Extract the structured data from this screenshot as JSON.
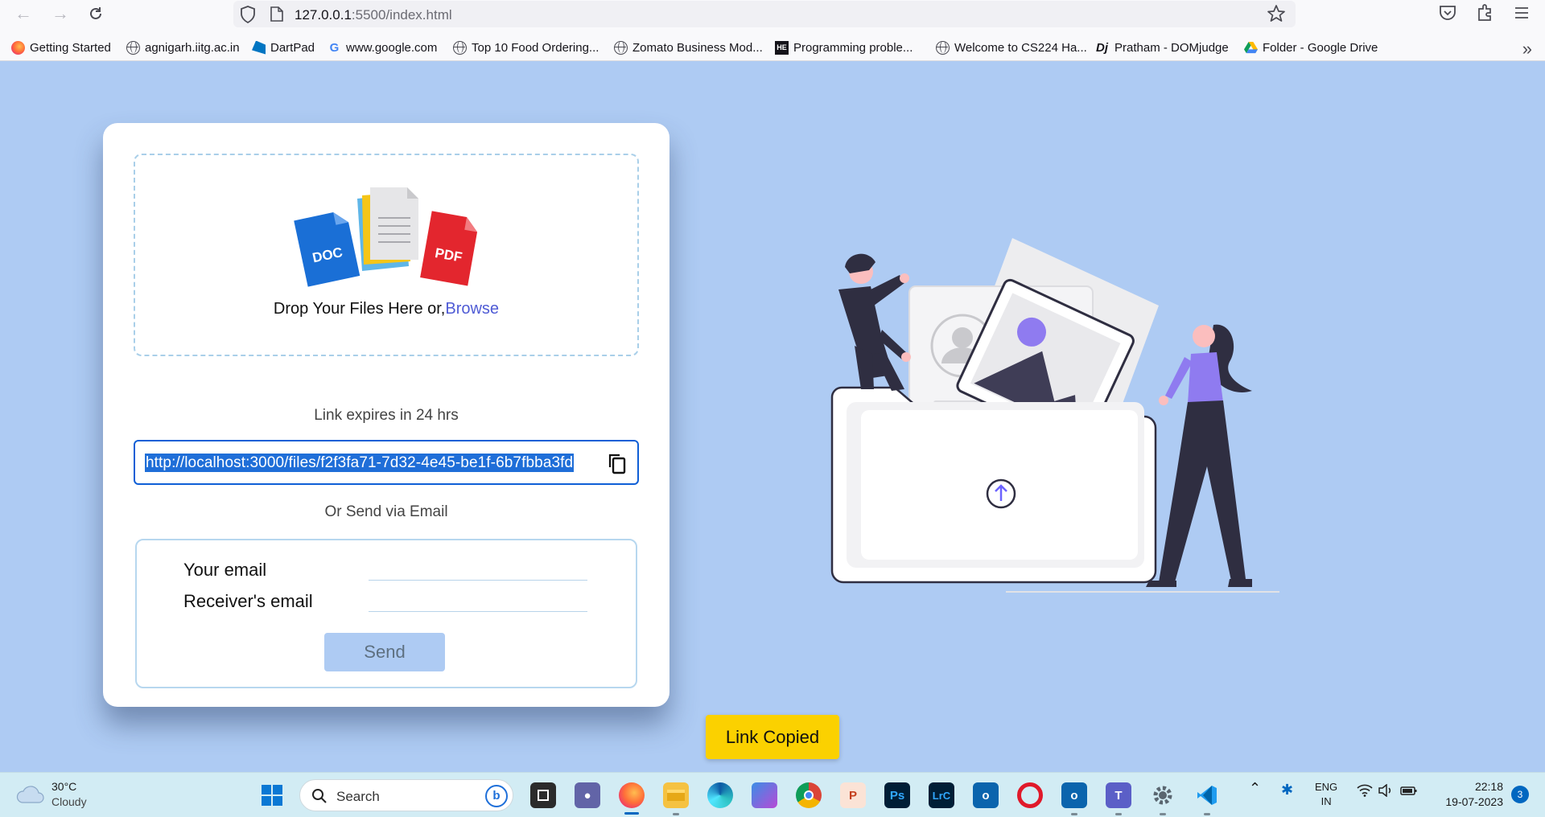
{
  "browser": {
    "url_host": "127.0.0.1",
    "url_rest": ":5500/index.html",
    "bookmarks": [
      {
        "label": "Getting Started",
        "icon": "firefox-icon"
      },
      {
        "label": "agnigarh.iitg.ac.in",
        "icon": "globe-icon"
      },
      {
        "label": "DartPad",
        "icon": "dart-icon"
      },
      {
        "label": "www.google.com",
        "icon": "google-icon"
      },
      {
        "label": "Top 10 Food Ordering...",
        "icon": "globe-icon"
      },
      {
        "label": "Zomato Business Mod...",
        "icon": "globe-icon"
      },
      {
        "label": "Programming proble...",
        "icon": "hackerearth-icon"
      },
      {
        "label": "Welcome to CS224 Ha...",
        "icon": "globe-icon"
      },
      {
        "label": "Pratham - DOMjudge",
        "icon": "domjudge-icon"
      },
      {
        "label": "Folder - Google Drive",
        "icon": "google-drive-icon"
      }
    ]
  },
  "card": {
    "drop_text": "Drop Your Files Here or,",
    "browse_label": "Browse",
    "expires_text": "Link expires in 24 hrs",
    "share_link": "http://localhost:3000/files/f2f3fa71-7d32-4e45-be1f-6b7fbba3fd",
    "or_send_text": "Or Send via Email",
    "your_email_label": "Your email",
    "receiver_email_label": "Receiver's email",
    "send_label": "Send",
    "doc_badge": "DOC",
    "pdf_badge": "PDF"
  },
  "toast": {
    "text": "Link Copied"
  },
  "taskbar": {
    "temperature": "30°C",
    "weather": "Cloudy",
    "search_placeholder": "Search",
    "lang_top": "ENG",
    "lang_bottom": "IN",
    "time": "22:18",
    "date": "19-07-2023",
    "notifications": "3",
    "ps_label": "Ps",
    "lrc_label": "LrC"
  },
  "colors": {
    "page_bg": "#aecbf3",
    "accent": "#4f5bd5",
    "toast": "#fbd100",
    "link_highlight": "#1f6ed8"
  }
}
